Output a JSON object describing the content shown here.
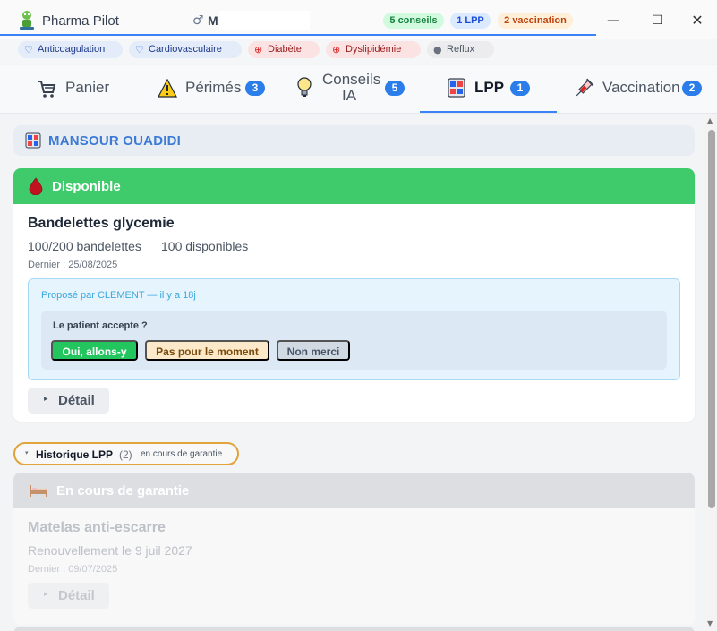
{
  "app": {
    "name": "Pharma Pilot",
    "gender_symbol": "♂",
    "patient_initial": "M"
  },
  "header_pills": {
    "conseils": "5 conseils",
    "lpp": "1 LPP",
    "vaccination": "2 vaccination"
  },
  "window_controls": {
    "minimize": "—",
    "maximize": "☐",
    "close": "✕"
  },
  "tags": [
    {
      "label": "Anticoagulation",
      "icon": "heart-icon",
      "color": "#2563eb"
    },
    {
      "label": "Cardiovasculaire",
      "icon": "heart-icon",
      "color": "#2563eb"
    },
    {
      "label": "Diabète",
      "icon": "target-icon",
      "color": "#dc2626"
    },
    {
      "label": "Dyslipidémie",
      "icon": "target-icon",
      "color": "#dc2626"
    },
    {
      "label": "Reflux",
      "icon": "dot-icon",
      "color": "#6b7280"
    }
  ],
  "tabs": [
    {
      "label": "Panier",
      "icon": "cart-icon",
      "badge": ""
    },
    {
      "label": "Périmés",
      "icon": "warning-icon",
      "badge": "3"
    },
    {
      "label": "Conseils IA",
      "label_line1": "Conseils",
      "label_line2": "IA",
      "icon": "lightbulb-icon",
      "badge": "5"
    },
    {
      "label": "LPP",
      "icon": "medical-device-icon",
      "badge": "1",
      "active": true
    },
    {
      "label": "Vaccination",
      "icon": "syringe-icon",
      "badge": "2"
    }
  ],
  "patient": {
    "name": "MANSOUR OUADIDI"
  },
  "lpp_card": {
    "status": "Disponible",
    "status_color": "#3fcb6c",
    "product": "Bandelettes glycemie",
    "quantity": "100/200 bandelettes",
    "available": "100 disponibles",
    "last_date": "Dernier : 25/08/2025",
    "proposal": "Proposé par CLEMENT — il y a 18j",
    "question": "Le patient accepte ?",
    "btn_yes": "Oui, allons-y",
    "btn_later": "Pas pour le moment",
    "btn_no": "Non merci",
    "detail": "Détail"
  },
  "history": {
    "title": "Historique LPP",
    "count": "(2)",
    "status": "en cours de garantie"
  },
  "history_card": {
    "status": "En cours de garantie",
    "product": "Matelas anti-escarre",
    "renewal": "Renouvellement le 9 juil 2027",
    "last_date": "Dernier : 09/07/2025",
    "detail": "Détail"
  }
}
